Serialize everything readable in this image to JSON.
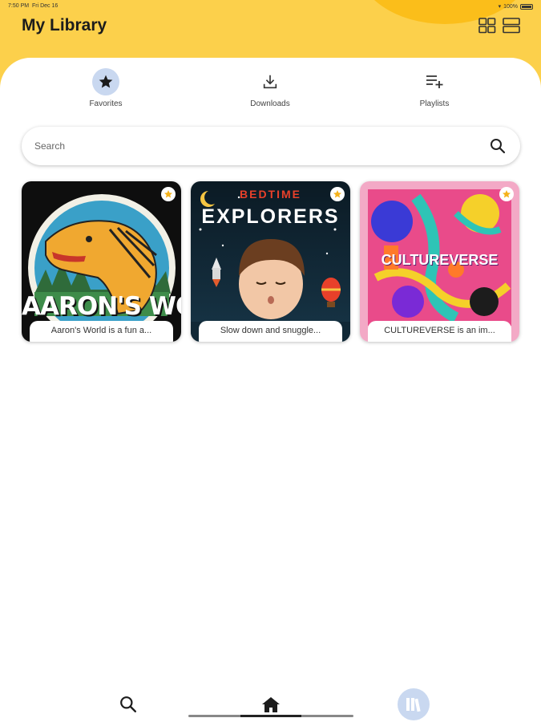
{
  "status_bar": {
    "time": "7:50 PM",
    "date": "Fri Dec 16",
    "battery": "100%"
  },
  "header": {
    "title": "My Library",
    "view_grid_icon": "grid-view-icon",
    "view_list_icon": "list-view-icon"
  },
  "tabs": [
    {
      "label": "Favorites",
      "icon": "star-icon",
      "active": true
    },
    {
      "label": "Downloads",
      "icon": "download-icon",
      "active": false
    },
    {
      "label": "Playlists",
      "icon": "playlist-add-icon",
      "active": false
    }
  ],
  "search": {
    "placeholder": "Search",
    "value": ""
  },
  "cards": [
    {
      "cover_title": "AARON'S WORLD",
      "caption": "Aaron's World is a fun a...",
      "favorite": true
    },
    {
      "cover_title_top": "BEDTIME",
      "cover_title": "EXPLORERS",
      "caption": "Slow down and snuggle...",
      "favorite": true
    },
    {
      "cover_title": "CULTUREVERSE",
      "caption": "CULTUREVERSE is an im...",
      "favorite": true
    }
  ],
  "bottom_nav": [
    {
      "icon": "search-icon",
      "active": false
    },
    {
      "icon": "home-icon",
      "active": false
    },
    {
      "icon": "library-icon",
      "active": true
    }
  ],
  "colors": {
    "header_yellow": "#fcd04b",
    "accent_blue": "#c9d8f0",
    "star_gold": "#f5b21a"
  }
}
